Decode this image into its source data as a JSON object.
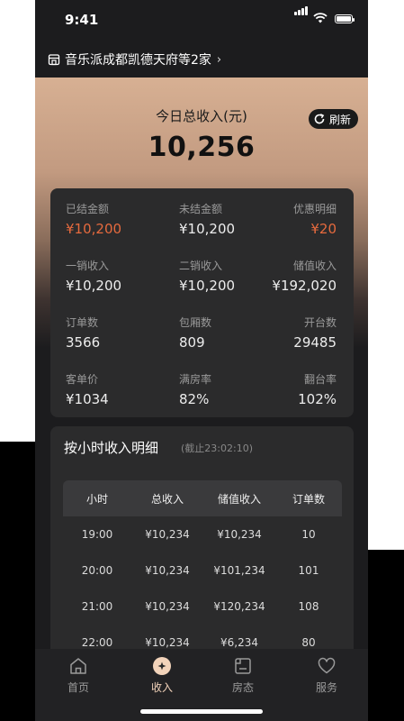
{
  "status_bar": {
    "time": "9:41"
  },
  "header": {
    "store_name": "音乐派成都凯德天府等2家",
    "chevron": "›"
  },
  "summary": {
    "label": "今日总收入(元)",
    "amount": "10,256",
    "refresh_label": "刷新"
  },
  "stats": [
    {
      "title": "已结金额",
      "value": "¥10,200",
      "highlight": true
    },
    {
      "title": "未结金额",
      "value": "¥10,200",
      "highlight": false
    },
    {
      "title": "优惠明细",
      "value": "¥20",
      "highlight": true
    },
    {
      "title": "一销收入",
      "value": "¥10,200",
      "highlight": false
    },
    {
      "title": "二销收入",
      "value": "¥10,200",
      "highlight": false
    },
    {
      "title": "储值收入",
      "value": "¥192,020",
      "highlight": false
    },
    {
      "title": "订单数",
      "value": "3566",
      "highlight": false
    },
    {
      "title": "包厢数",
      "value": "809",
      "highlight": false
    },
    {
      "title": "开台数",
      "value": "29485",
      "highlight": false
    },
    {
      "title": "客单价",
      "value": "¥1034",
      "highlight": false
    },
    {
      "title": "满房率",
      "value": "82%",
      "highlight": false
    },
    {
      "title": "翻台率",
      "value": "102%",
      "highlight": false
    }
  ],
  "hourly": {
    "title": "按小时收入明细",
    "subtitle": "(截止23:02:10)",
    "columns": [
      "小时",
      "总收入",
      "储值收入",
      "订单数"
    ],
    "rows": [
      [
        "19:00",
        "¥10,234",
        "¥10,234",
        "10"
      ],
      [
        "20:00",
        "¥10,234",
        "¥101,234",
        "101"
      ],
      [
        "21:00",
        "¥10,234",
        "¥120,234",
        "108"
      ],
      [
        "22:00",
        "¥10,234",
        "¥6,234",
        "80"
      ]
    ]
  },
  "tabs": [
    {
      "label": "首页",
      "icon": "home-icon",
      "active": false
    },
    {
      "label": "收入",
      "icon": "income-icon",
      "active": true
    },
    {
      "label": "房态",
      "icon": "room-icon",
      "active": false
    },
    {
      "label": "服务",
      "icon": "heart-icon",
      "active": false
    }
  ],
  "colors": {
    "accent": "#e66a3e",
    "tab_active": "#f2d3ba",
    "hero_top": "#d7b093"
  }
}
